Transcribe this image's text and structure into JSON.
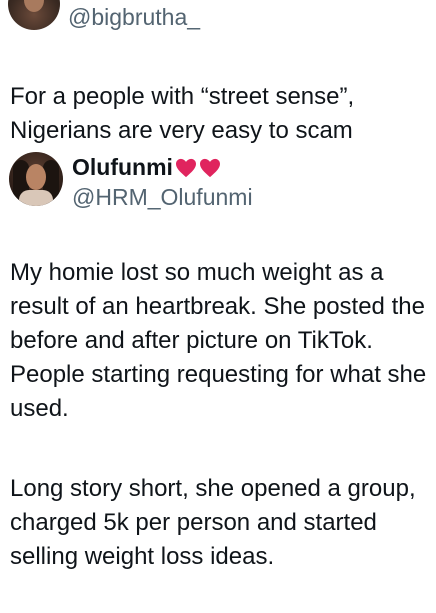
{
  "top_tweet": {
    "handle": "@bigbrutha_",
    "text": "For a people with “street sense”, Nigerians are very easy to scam"
  },
  "quoted_tweet": {
    "display_name": "Olufunmi",
    "name_emoji": [
      "red-heart-icon",
      "red-heart-icon"
    ],
    "handle": "@HRM_Olufunmi",
    "paragraph_1": "My homie lost so much weight as a result of an heartbreak. She posted the before and after picture on TikTok. People starting requesting for what she used.",
    "paragraph_2": "Long story short, she opened a group, charged 5k per person and started selling weight loss ideas."
  },
  "colors": {
    "text": "#0f1419",
    "secondary": "#536471",
    "heart": "#e0245e"
  }
}
